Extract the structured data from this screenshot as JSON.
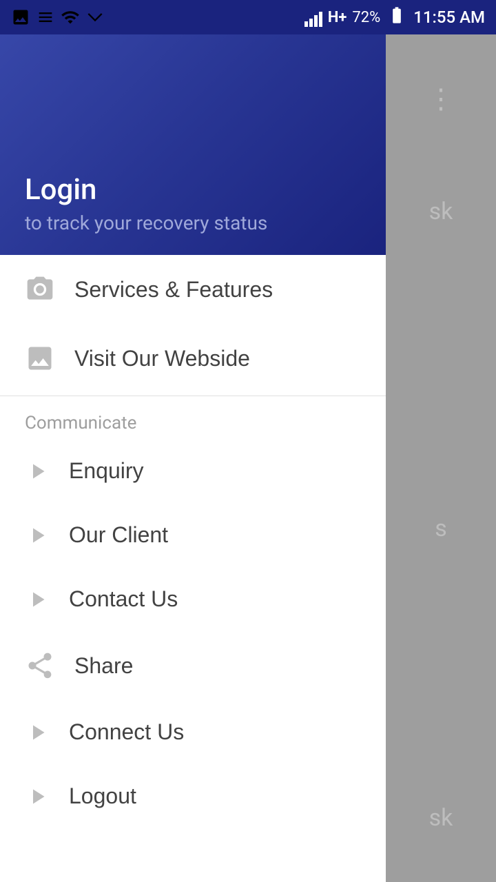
{
  "statusBar": {
    "time": "11:55 AM",
    "battery": "72%",
    "signal": "H+"
  },
  "drawer": {
    "header": {
      "title": "Login",
      "subtitle": "to track your recovery status"
    },
    "topMenuItems": [
      {
        "id": "services-features",
        "label": "Services & Features",
        "icon": "camera-icon"
      },
      {
        "id": "visit-website",
        "label": "Visit Our Webside",
        "icon": "image-icon"
      }
    ],
    "communicateSection": {
      "label": "Communicate",
      "items": [
        {
          "id": "enquiry",
          "label": "Enquiry",
          "icon": "arrow-icon"
        },
        {
          "id": "our-client",
          "label": "Our Client",
          "icon": "arrow-icon"
        },
        {
          "id": "contact-us",
          "label": "Contact Us",
          "icon": "arrow-icon"
        },
        {
          "id": "share",
          "label": "Share",
          "icon": "share-icon"
        },
        {
          "id": "connect-us",
          "label": "Connect Us",
          "icon": "arrow-icon"
        },
        {
          "id": "logout",
          "label": "Logout",
          "icon": "arrow-icon"
        }
      ]
    }
  },
  "rightOverlay": {
    "text1": "sk",
    "text2": "s",
    "text3": "sk"
  }
}
